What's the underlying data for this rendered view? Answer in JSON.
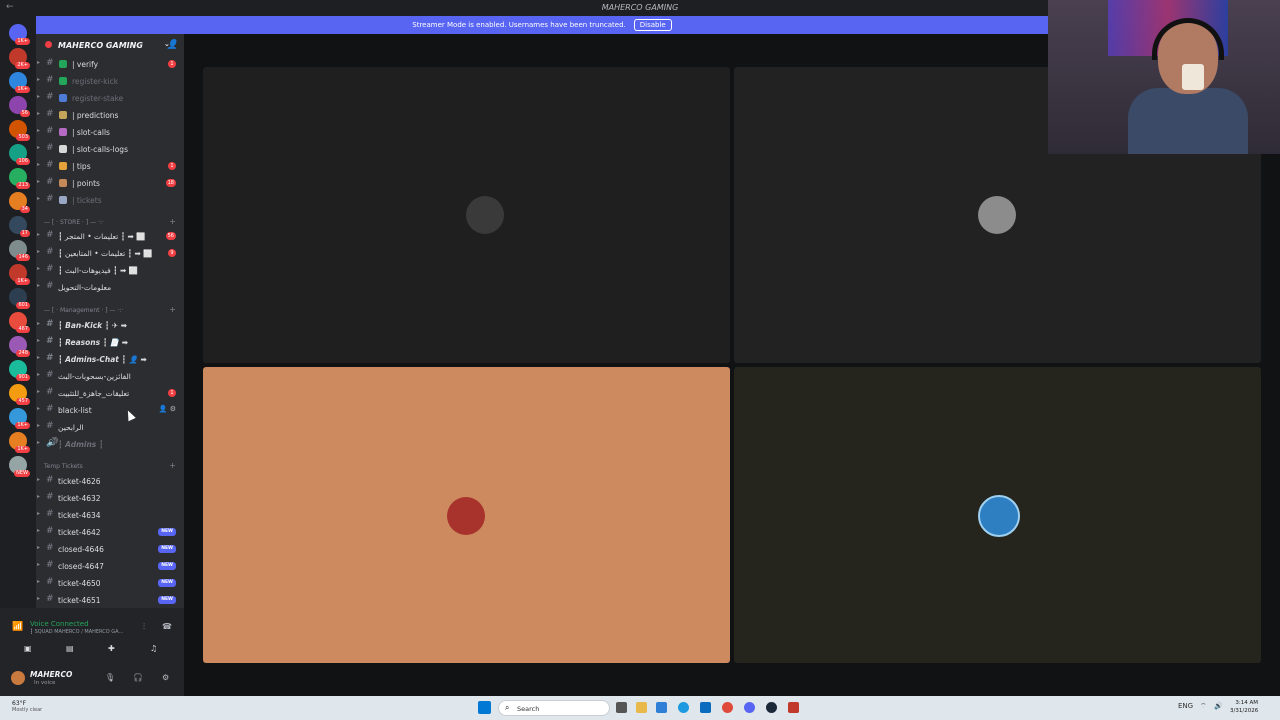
{
  "window": {
    "title": "MAHERCO GAMING",
    "back_icon": "arrow-left-icon"
  },
  "banner": {
    "text": "Streamer Mode is enabled. Usernames have been truncated.",
    "button": "Disable",
    "color": "#5865f2"
  },
  "guild_badges": [
    "1K+",
    "2K+",
    "1K+",
    "56",
    "503",
    "106",
    "213",
    "34",
    "17",
    "146",
    "1K+",
    "601",
    "467",
    "248",
    "901",
    "457",
    "1K+",
    "1K+",
    "NEW"
  ],
  "server": {
    "name": "MAHERCO GAMING",
    "add_member_icon": "add-member-icon"
  },
  "channels": [
    {
      "label": "| verify",
      "emoji_color": "#23a55a",
      "count": "1",
      "muted": false
    },
    {
      "label": "register-kick",
      "emoji_color": "#23a55a",
      "count": "",
      "muted": true
    },
    {
      "label": "register-stake",
      "emoji_color": "#4e7ad8",
      "count": "",
      "muted": true
    },
    {
      "label": "| predictions",
      "emoji_color": "#c4a45a",
      "count": "",
      "muted": false
    },
    {
      "label": "| slot-calls",
      "emoji_color": "#b56ac4",
      "count": "",
      "muted": false
    },
    {
      "label": "| slot-calls-logs",
      "emoji_color": "#d8d8d8",
      "count": "",
      "muted": false
    },
    {
      "label": "| tips",
      "emoji_color": "#e3a33a",
      "count": "1",
      "muted": false
    },
    {
      "label": "| points",
      "emoji_color": "#c48a5a",
      "count": "18",
      "muted": false
    },
    {
      "label": "| tickets",
      "emoji_color": "#9aa7c4",
      "count": "",
      "muted": true
    }
  ],
  "categories": {
    "store": "— [ · STORE · ] — ·:·",
    "management": "— [ · Management · ] — ·:·",
    "temp": "Temp Tickets"
  },
  "store_channels": [
    {
      "label": "┇ تعليمات • المتجر ┇ ➡ ⬜",
      "count": "56"
    },
    {
      "label": "┇ تعليمات • المتابعين ┇ ➡ ⬜",
      "count": "9"
    },
    {
      "label": "┇ فيديوهات-البث ┇ ➡ ⬜",
      "count": ""
    },
    {
      "label": "معلومات-التحويل",
      "count": ""
    }
  ],
  "management_channels": [
    {
      "label": "┇ Ban-Kick ┇ ✈ ➡",
      "bold": true,
      "count": ""
    },
    {
      "label": "┇ Reasons ┇ 📄 ➡",
      "bold": true,
      "count": ""
    },
    {
      "label": "┇ Admins-Chat ┇ 👤 ➡",
      "bold": true,
      "count": ""
    },
    {
      "label": "الفائزين-بسحوبات-البث",
      "bold": false,
      "count": ""
    },
    {
      "label": "تعليقات_جاهزة_للتثبيت",
      "bold": false,
      "count": "1"
    },
    {
      "label": "black-list",
      "bold": false,
      "count": "",
      "tools": "👤 ⚙"
    },
    {
      "label": "الرابحين",
      "bold": false,
      "count": ""
    }
  ],
  "voice_channel": {
    "label": "┇ Admins ┇"
  },
  "tickets": [
    {
      "label": "ticket-4626",
      "tag": ""
    },
    {
      "label": "ticket-4632",
      "tag": ""
    },
    {
      "label": "ticket-4634",
      "tag": ""
    },
    {
      "label": "ticket-4642",
      "tag": "NEW"
    },
    {
      "label": "closed-4646",
      "tag": "NEW"
    },
    {
      "label": "closed-4647",
      "tag": "NEW"
    },
    {
      "label": "ticket-4650",
      "tag": "NEW"
    },
    {
      "label": "ticket-4651",
      "tag": "NEW"
    }
  ],
  "voice_panel": {
    "status": "Voice Connected",
    "channel": "┇ SQUAD MAHERCO / MAHERCO GA...",
    "icons": [
      "signal-icon",
      "noise-suppression-icon",
      "disconnect-icon",
      "camera-icon",
      "screen-share-icon",
      "activities-icon",
      "soundboard-icon"
    ]
  },
  "user_panel": {
    "name": "MAHERCO",
    "status": "In voice",
    "icons": [
      "mic-icon",
      "headphones-icon",
      "settings-icon"
    ]
  },
  "tiles": [
    {
      "bg": "#1f1f1f",
      "avatar": "#3a3a3a"
    },
    {
      "bg": "#222222",
      "avatar": "#8c8c8c"
    },
    {
      "bg": "#cd8a5f",
      "avatar": "#a8322c"
    },
    {
      "bg": "#25251e",
      "avatar": "#2d7fc2"
    }
  ],
  "taskbar": {
    "weather_temp": "63°F",
    "weather_desc": "Mostly clear",
    "search": "Search",
    "lang": "ENG",
    "time": "3:14 AM",
    "date": "3/31/2026"
  }
}
